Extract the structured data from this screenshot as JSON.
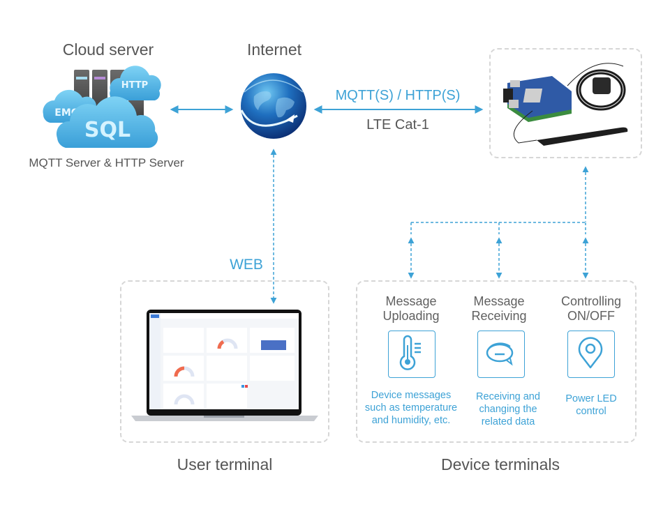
{
  "colors": {
    "accent": "#3da2d6",
    "text": "#555555",
    "dashed_border": "#d6d6d6"
  },
  "cloud_server": {
    "title": "Cloud server",
    "caption": "MQTT Server & HTTP Server",
    "cloud_labels": [
      "EMQ",
      "HTTP",
      "SQL"
    ]
  },
  "internet": {
    "title": "Internet",
    "link_protocol": "MQTT(S) / HTTP(S)",
    "link_network": "LTE Cat-1",
    "web_label": "WEB"
  },
  "user_terminal": {
    "title": "User terminal"
  },
  "device_terminals": {
    "title": "Device terminals",
    "features": [
      {
        "title": "Message\nUploading",
        "icon": "thermometer-icon",
        "description": "Device messages\nsuch as temperature\nand humidity, etc."
      },
      {
        "title": "Message\nReceiving",
        "icon": "chat-bubble-icon",
        "description": "Receiving and\nchanging the\nrelated data"
      },
      {
        "title": "Controlling\nON/OFF",
        "icon": "location-pin-icon",
        "description": "Power LED\ncontrol"
      }
    ]
  }
}
